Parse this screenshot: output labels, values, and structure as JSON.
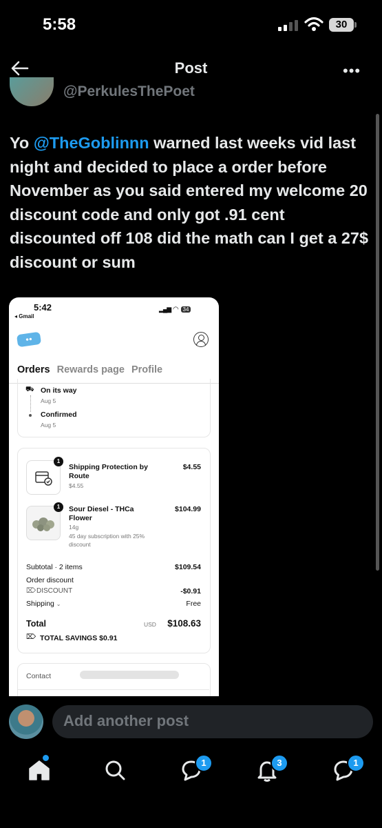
{
  "status_bar": {
    "time": "5:58",
    "battery": "30"
  },
  "nav": {
    "title": "Post"
  },
  "author": {
    "handle": "@PerkulesThePoet"
  },
  "post": {
    "text_before": "Yo ",
    "mention": "@TheGoblinnn",
    "text_after": " warned last weeks vid last night and decided to place a order before November as you said entered my welcome 20 discount code and only got .91 cent discounted off 108 did the math can I get a 27$ discount or sum"
  },
  "embed": {
    "time": "5:42",
    "back_app": "◂ Gmail",
    "battery": "34",
    "tabs": [
      "Orders",
      "Rewards page",
      "Profile"
    ],
    "tracking": [
      {
        "status": "On its way",
        "date": "Aug 5"
      },
      {
        "status": "Confirmed",
        "date": "Aug 5"
      }
    ],
    "items": [
      {
        "qty": "1",
        "name": "Shipping Protection by Route",
        "sub": "$4.55",
        "price": "$4.55"
      },
      {
        "qty": "1",
        "name": "Sour Diesel - THCa Flower",
        "weight": "14g",
        "note": "45 day subscription with 25% discount",
        "price": "$104.99"
      }
    ],
    "subtotal_label": "Subtotal · 2 items",
    "subtotal_value": "$109.54",
    "order_discount_label": "Order discount",
    "discount_code": "DISCOUNT",
    "discount_value": "-$0.91",
    "shipping_label": "Shipping",
    "shipping_value": "Free",
    "total_label": "Total",
    "total_currency": "USD",
    "total_value": "$108.63",
    "savings": "TOTAL SAVINGS $0.91",
    "contact_label": "Contact"
  },
  "reply": {
    "placeholder": "Add another post"
  },
  "tabbar": {
    "messages_badge": "1",
    "notifications_badge": "3",
    "chat_badge": "1"
  },
  "colors": {
    "accent": "#1d9bf0",
    "background": "#000000"
  }
}
